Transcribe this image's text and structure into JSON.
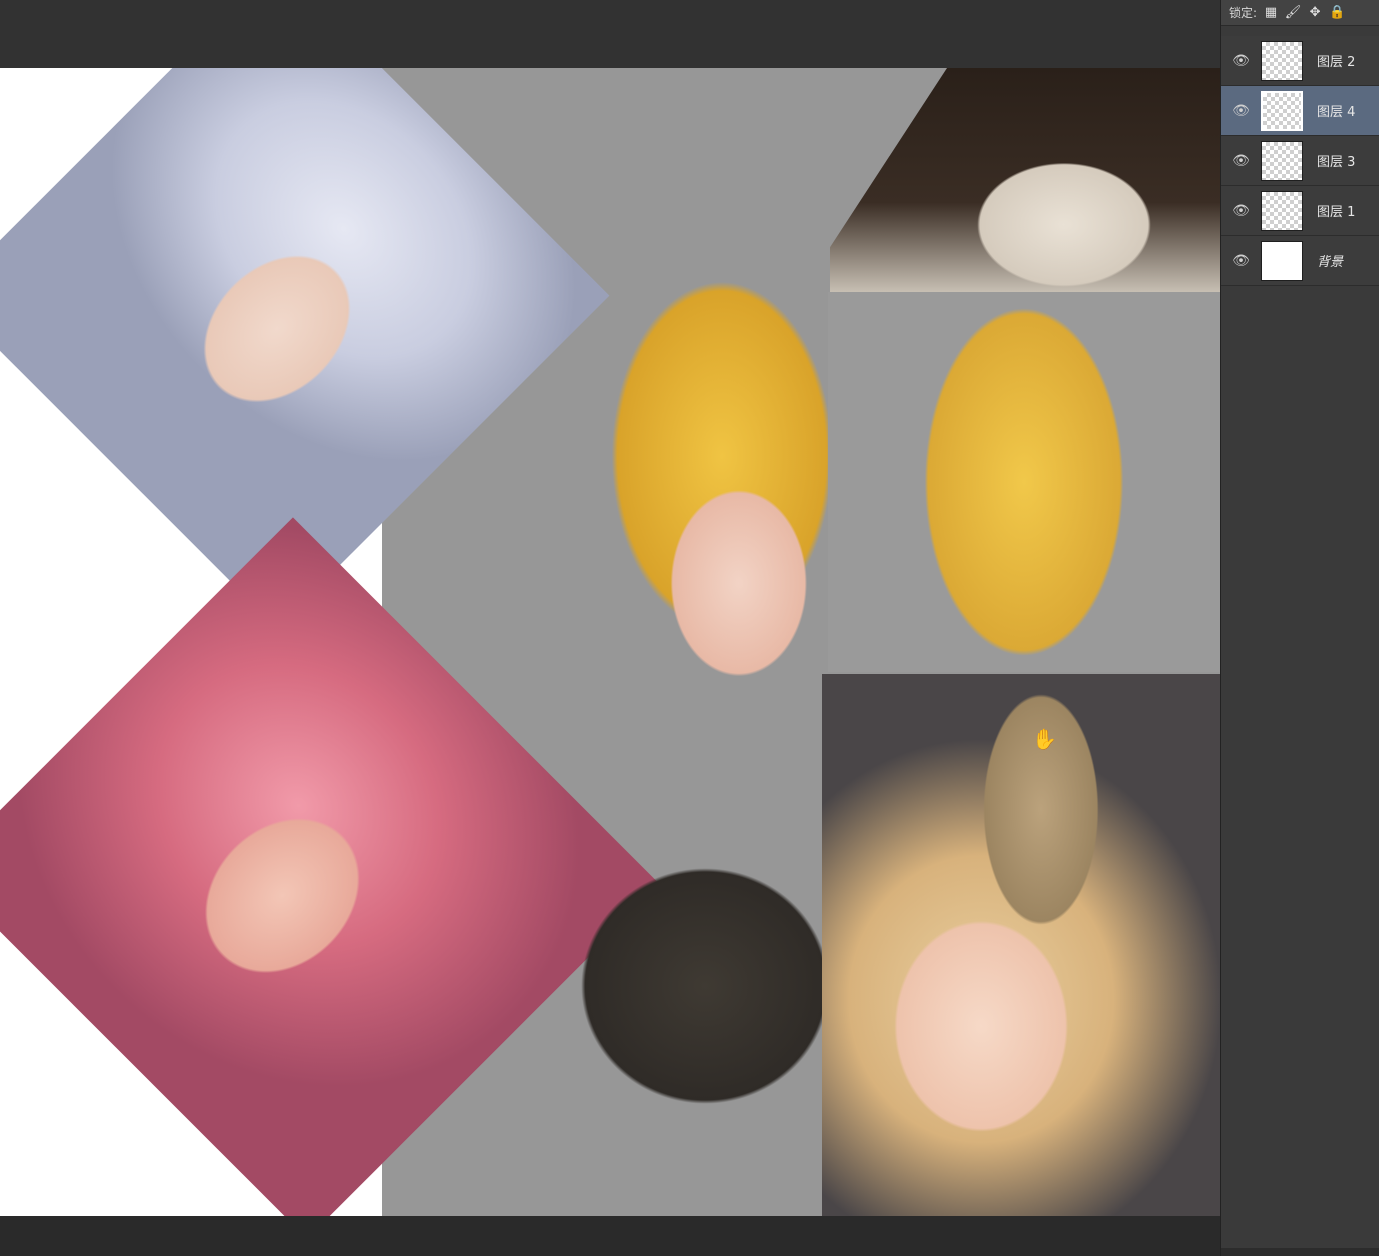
{
  "layers_panel": {
    "lock_label": "锁定:",
    "lock_buttons": [
      {
        "icon": "checker-lock-icon",
        "glyph": "▦"
      },
      {
        "icon": "brush-lock-icon",
        "glyph": "🖌"
      },
      {
        "icon": "move-lock-icon",
        "glyph": "✥"
      },
      {
        "icon": "padlock-icon",
        "glyph": "🔒"
      }
    ],
    "layers": [
      {
        "name": "图层 2",
        "selected": false,
        "visible_icon": "👁"
      },
      {
        "name": "图层 4",
        "selected": true,
        "visible_icon": "👁"
      },
      {
        "name": "图层 3",
        "selected": false,
        "visible_icon": "👁"
      },
      {
        "name": "图层 1",
        "selected": false,
        "visible_icon": "👁"
      },
      {
        "name": "背景",
        "selected": false,
        "visible_icon": "👁",
        "background": true
      }
    ]
  },
  "cursor": {
    "glyph": "✋"
  }
}
